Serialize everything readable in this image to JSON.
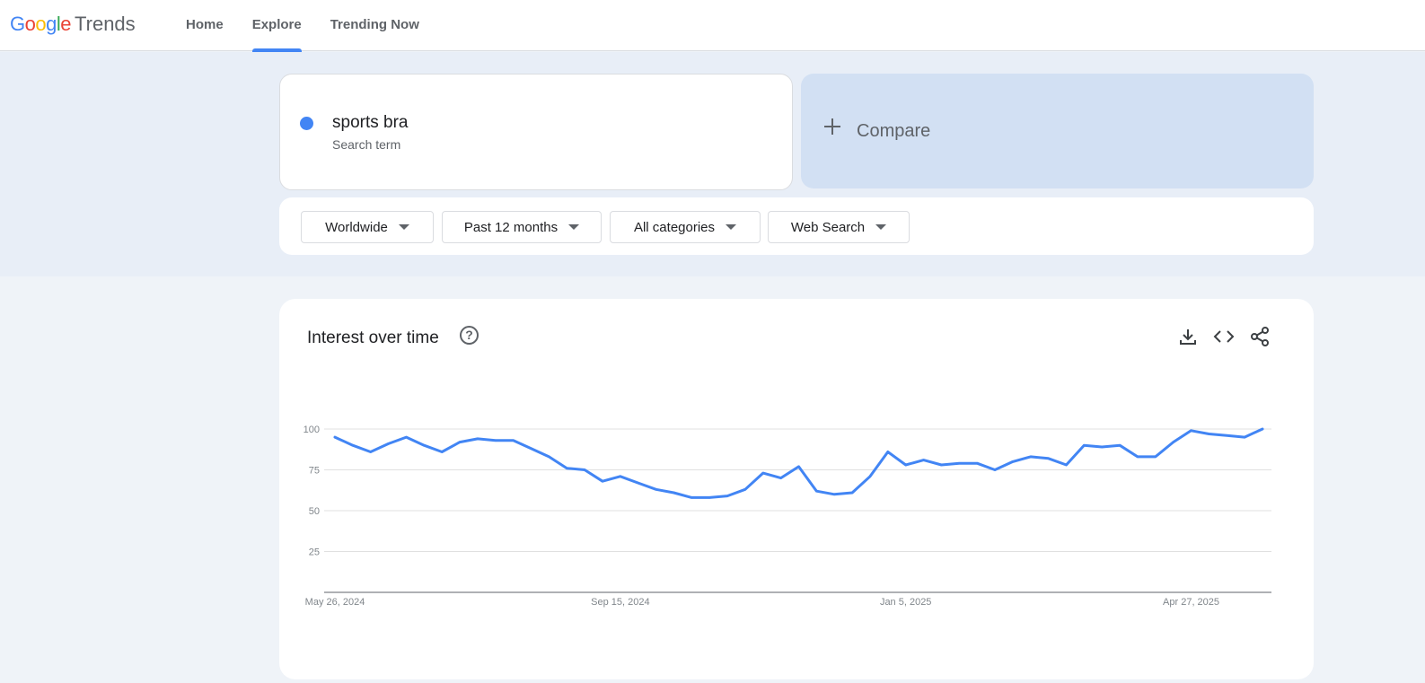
{
  "header": {
    "logo_letters": [
      {
        "ch": "G",
        "color": "#4285f4"
      },
      {
        "ch": "o",
        "color": "#ea4335"
      },
      {
        "ch": "o",
        "color": "#fbbc05"
      },
      {
        "ch": "g",
        "color": "#4285f4"
      },
      {
        "ch": "l",
        "color": "#34a853"
      },
      {
        "ch": "e",
        "color": "#ea4335"
      }
    ],
    "logo_product": "Trends",
    "nav": [
      {
        "label": "Home",
        "active": false
      },
      {
        "label": "Explore",
        "active": true
      },
      {
        "label": "Trending Now",
        "active": false
      }
    ]
  },
  "search": {
    "term": "sports bra",
    "term_type": "Search term",
    "term_color": "#4285f4",
    "compare_label": "Compare"
  },
  "filters": {
    "region": "Worldwide",
    "time_range": "Past 12 months",
    "category": "All categories",
    "search_type": "Web Search"
  },
  "chart_panel": {
    "title": "Interest over time",
    "help_icon": "help-circle-icon",
    "tools": [
      "download-icon",
      "embed-code-icon",
      "share-icon"
    ]
  },
  "chart_data": {
    "type": "line",
    "title": "Interest over time",
    "ylim": [
      0,
      100
    ],
    "y_ticks": [
      25,
      50,
      75,
      100
    ],
    "x_tick_labels": [
      "May 26, 2024",
      "Sep 15, 2024",
      "Jan 5, 2025",
      "Apr 27, 2025"
    ],
    "x_tick_index": [
      0,
      16,
      32,
      48
    ],
    "series": [
      {
        "name": "sports bra",
        "color": "#4285f4",
        "values": [
          95,
          90,
          86,
          91,
          95,
          90,
          86,
          92,
          94,
          93,
          93,
          88,
          83,
          76,
          75,
          68,
          71,
          67,
          63,
          61,
          58,
          58,
          59,
          63,
          73,
          70,
          77,
          62,
          60,
          61,
          71,
          86,
          78,
          81,
          78,
          79,
          79,
          75,
          80,
          83,
          82,
          78,
          90,
          89,
          90,
          83,
          83,
          92,
          99,
          97,
          96,
          95,
          100
        ]
      }
    ]
  }
}
